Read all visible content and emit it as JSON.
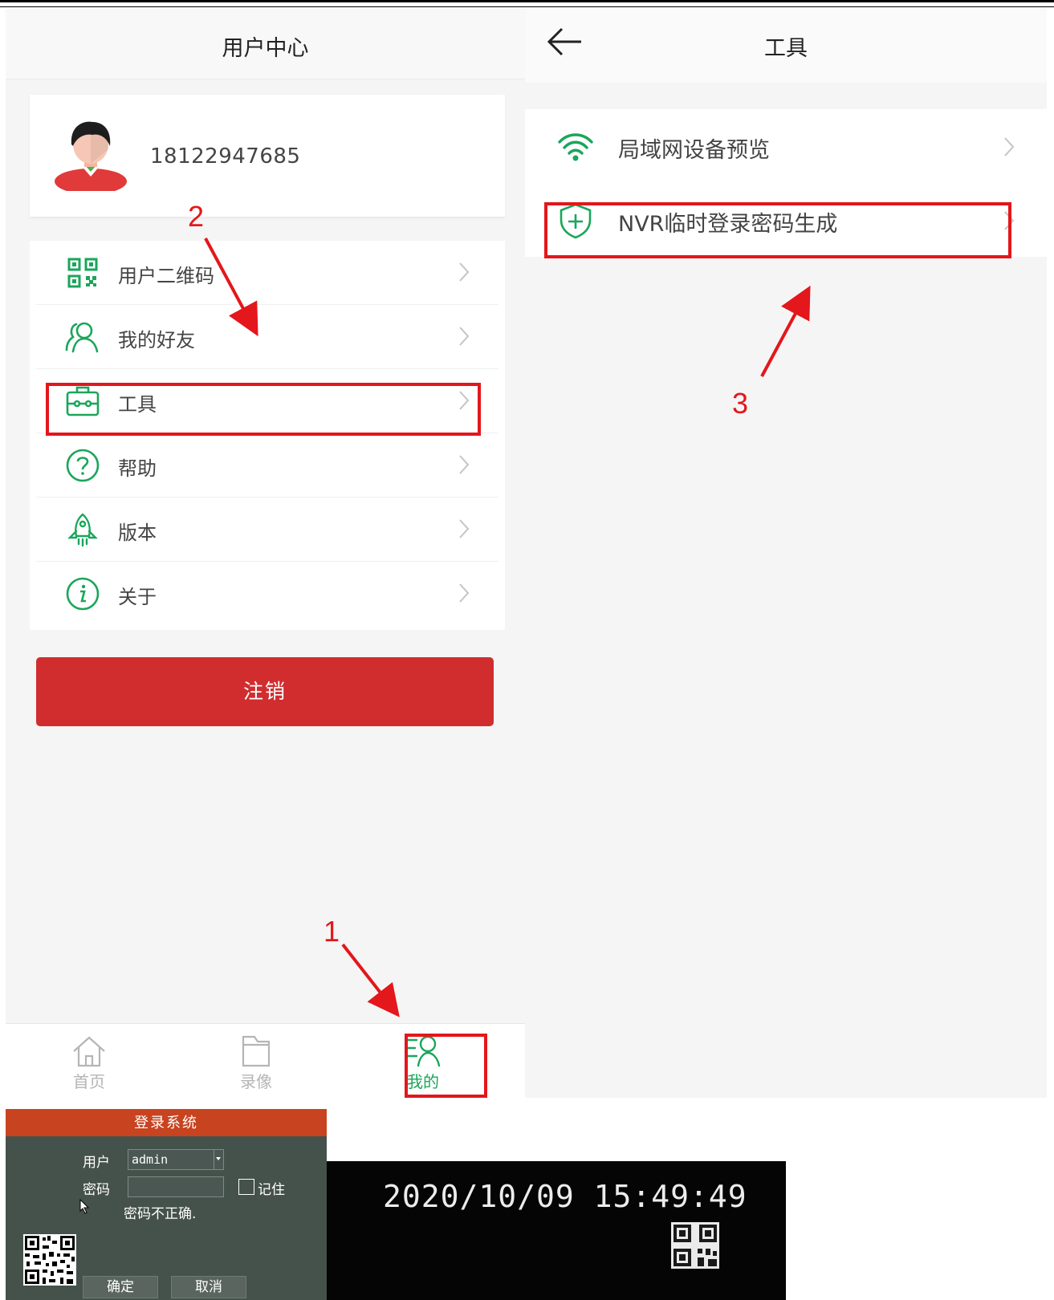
{
  "user_center": {
    "title": "用户中心",
    "phone": "18122947685",
    "menu": [
      {
        "label": "用户二维码",
        "icon": "qrcode-icon"
      },
      {
        "label": "我的好友",
        "icon": "friends-icon"
      },
      {
        "label": "工具",
        "icon": "toolbox-icon"
      },
      {
        "label": "帮助",
        "icon": "help-icon"
      },
      {
        "label": "版本",
        "icon": "rocket-icon"
      },
      {
        "label": "关于",
        "icon": "info-icon"
      }
    ],
    "logout_label": "注销",
    "nav": [
      {
        "label": "首页",
        "icon": "home-icon"
      },
      {
        "label": "录像",
        "icon": "folder-icon"
      },
      {
        "label": "我的",
        "icon": "profile-icon"
      }
    ]
  },
  "tools": {
    "title": "工具",
    "items": [
      {
        "label": "局域网设备预览",
        "icon": "wifi-icon"
      },
      {
        "label": "NVR临时登录密码生成",
        "icon": "shield-plus-icon"
      }
    ]
  },
  "annotations": {
    "step1": "1",
    "step2": "2",
    "step3": "3"
  },
  "nvr_login": {
    "title": "登录系统",
    "user_label": "用户",
    "user_value": "admin",
    "password_label": "密码",
    "password_value": "",
    "remember_label": "记住",
    "error": "密码不正确.",
    "ok_label": "确定",
    "cancel_label": "取消"
  },
  "nvr_time": {
    "datetime": "2020/10/09 15:49:49"
  },
  "colors": {
    "accent_green": "#1aa65a",
    "logout_red": "#d12d2f",
    "annotation_red": "#e3171c",
    "login_title": "#c8431f"
  }
}
